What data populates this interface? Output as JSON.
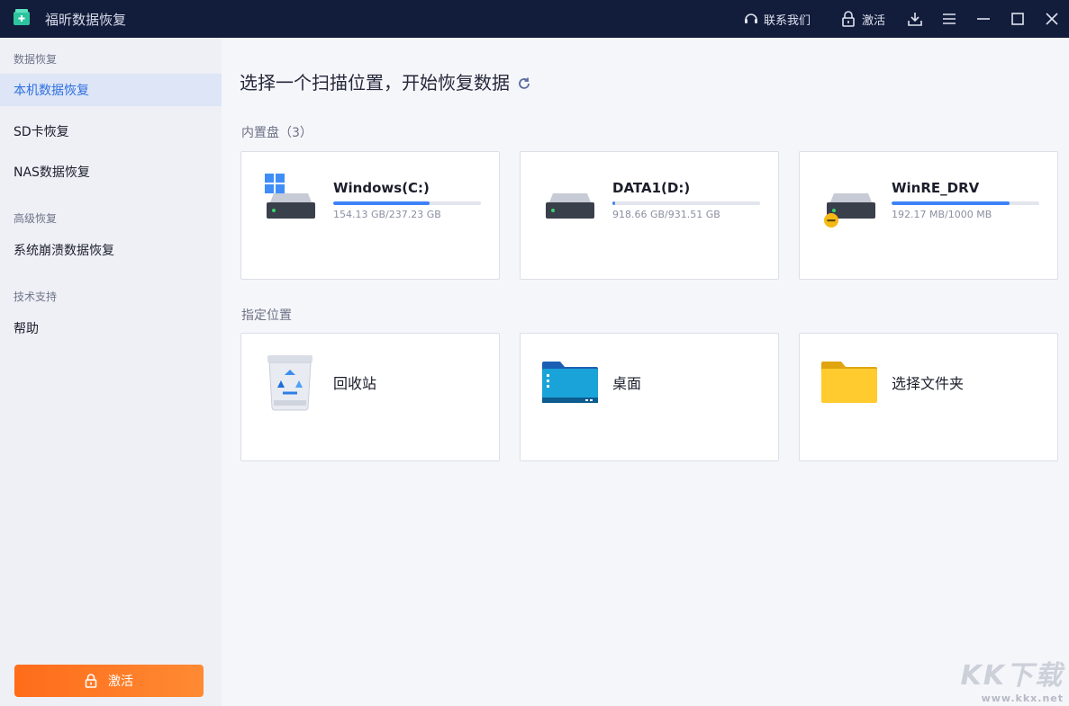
{
  "app": {
    "title": "福昕数据恢复"
  },
  "titlebar": {
    "contact_label": "联系我们",
    "activate_label": "激活",
    "icons": [
      "headset-icon",
      "lock-icon",
      "download-icon",
      "menu-icon",
      "minimize-icon",
      "maximize-icon",
      "close-icon"
    ]
  },
  "sidebar": {
    "groups": [
      {
        "label": "数据恢复"
      },
      {
        "label": "高级恢复"
      },
      {
        "label": "技术支持"
      }
    ],
    "items": [
      {
        "label": "本机数据恢复",
        "active": true
      },
      {
        "label": "SD卡恢复"
      },
      {
        "label": "NAS数据恢复"
      },
      {
        "label": "系统崩溃数据恢复"
      },
      {
        "label": "帮助"
      }
    ],
    "activate_button": "激活"
  },
  "main": {
    "title": "选择一个扫描位置，开始恢复数据",
    "internal_section": "内置盘（3）",
    "drives": [
      {
        "name": "Windows(C:)",
        "size": "154.13 GB/237.23 GB",
        "used_fraction": 0.65
      },
      {
        "name": "DATA1(D:)",
        "size": "918.66 GB/931.51 GB",
        "used_fraction": 0.02
      },
      {
        "name": "WinRE_DRV",
        "size": "192.17 MB/1000 MB",
        "used_fraction": 0.8
      }
    ],
    "locations_section": "指定位置",
    "locations": [
      {
        "name": "回收站"
      },
      {
        "name": "桌面"
      },
      {
        "name": "选择文件夹"
      }
    ]
  },
  "watermark": {
    "big": "KK下载",
    "small": "www.kkx.net"
  },
  "colors": {
    "titlebar": "#121c3b",
    "accent": "#3e82f7",
    "activate": "#ff7a28",
    "sidebar_active": "#dde5f6"
  }
}
